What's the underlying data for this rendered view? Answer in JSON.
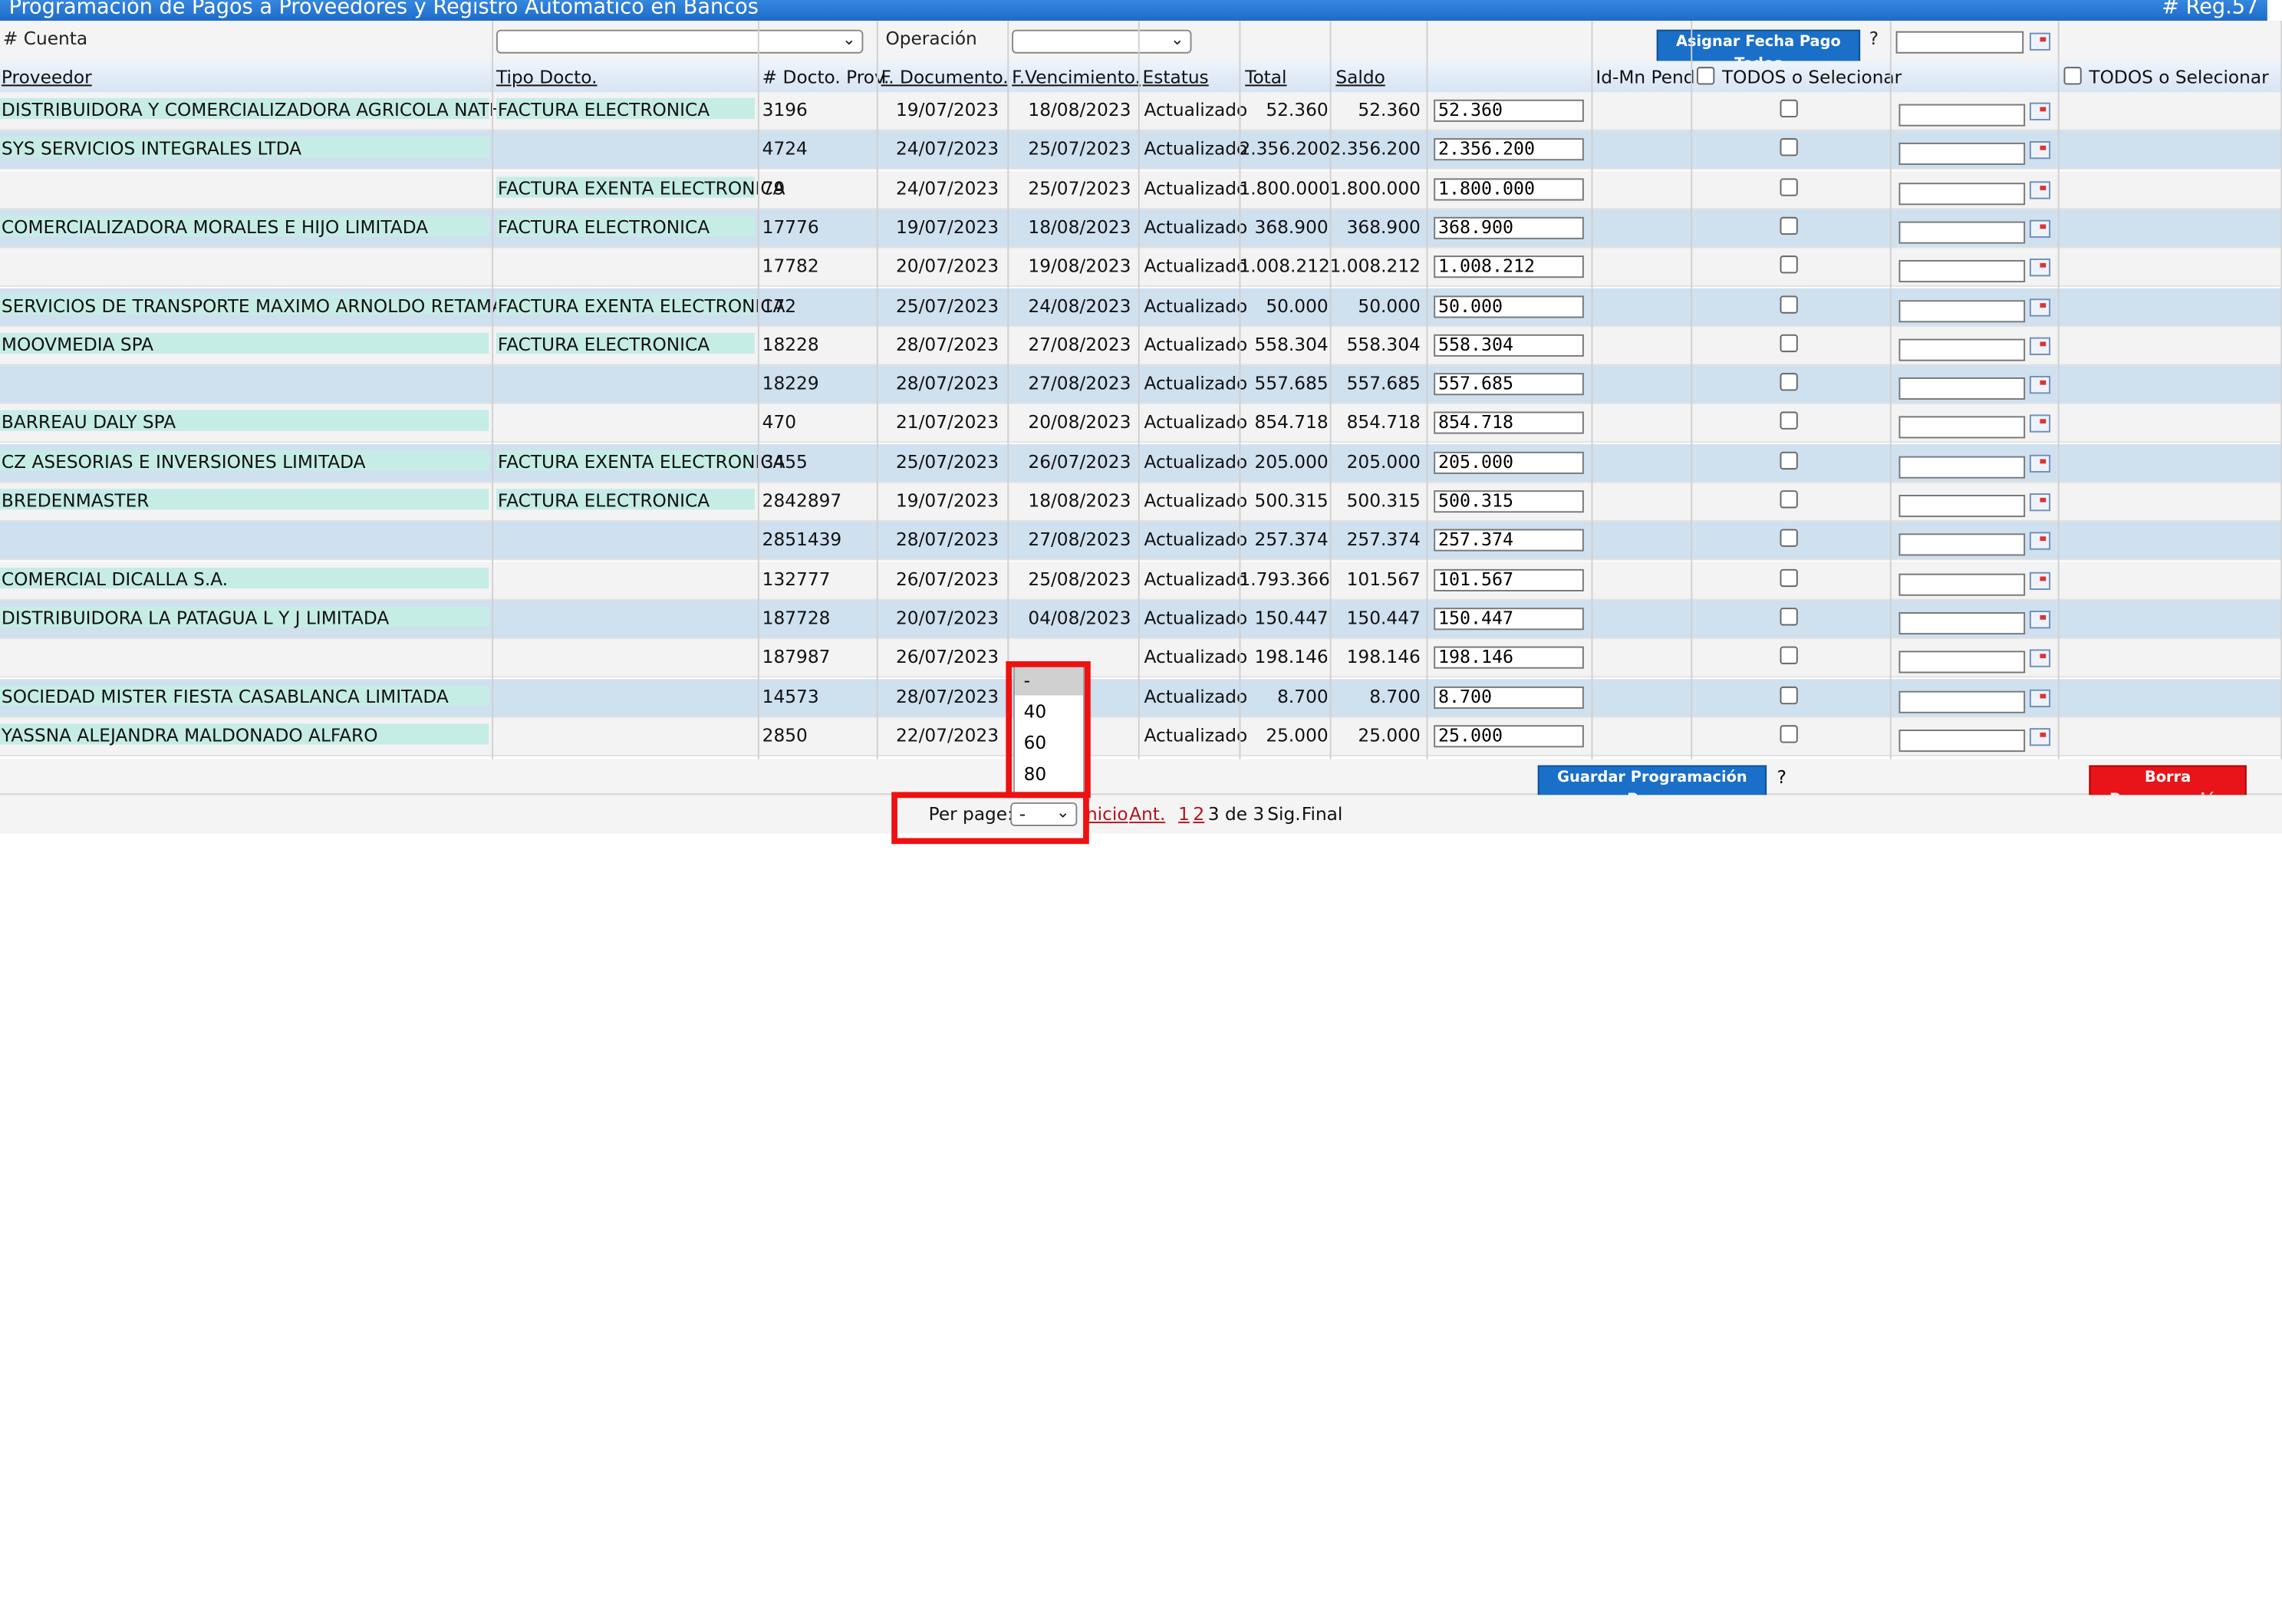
{
  "title": "Programación de Pagos a Proveedores y Registro Automatico en Bancos",
  "reg": "# Reg.57",
  "filters": {
    "cuenta_label": "# Cuenta",
    "operacion_label": "Operación",
    "asignar_button": "Asignar Fecha Pago Todos",
    "help": "?"
  },
  "columns": {
    "proveedor": "Proveedor",
    "tipo": "Tipo Docto.",
    "num": "# Docto. Prov.",
    "fdoc": "F. Documento.",
    "fven": "F.Vencimiento.",
    "estatus": "Estatus",
    "total": "Total",
    "saldo": "Saldo",
    "idmn": "Id-Mn Pend",
    "todos1": "TODOS o Selecionar",
    "todos2": "TODOS o Selecionar"
  },
  "rows": [
    {
      "proveedor": "DISTRIBUIDORA Y COMERCIALIZADORA AGRICOLA NATHALIE",
      "tipo": "FACTURA ELECTRONICA",
      "num": "3196",
      "fdoc": "19/07/2023",
      "fven": "18/08/2023",
      "estatus": "Actualizado",
      "total": "52.360",
      "saldo": "52.360",
      "monto": "52.360"
    },
    {
      "proveedor": "SYS SERVICIOS INTEGRALES LTDA",
      "tipo": "",
      "num": "4724",
      "fdoc": "24/07/2023",
      "fven": "25/07/2023",
      "estatus": "Actualizado",
      "total": "2.356.200",
      "saldo": "2.356.200",
      "monto": "2.356.200"
    },
    {
      "proveedor": "",
      "tipo": "FACTURA EXENTA ELECTRONICA",
      "num": "79",
      "fdoc": "24/07/2023",
      "fven": "25/07/2023",
      "estatus": "Actualizado",
      "total": "1.800.000",
      "saldo": "1.800.000",
      "monto": "1.800.000"
    },
    {
      "proveedor": "COMERCIALIZADORA MORALES E HIJO LIMITADA",
      "tipo": "FACTURA ELECTRONICA",
      "num": "17776",
      "fdoc": "19/07/2023",
      "fven": "18/08/2023",
      "estatus": "Actualizado",
      "total": "368.900",
      "saldo": "368.900",
      "monto": "368.900"
    },
    {
      "proveedor": "",
      "tipo": "",
      "num": "17782",
      "fdoc": "20/07/2023",
      "fven": "19/08/2023",
      "estatus": "Actualizado",
      "total": "1.008.212",
      "saldo": "1.008.212",
      "monto": "1.008.212"
    },
    {
      "proveedor": "SERVICIOS DE TRANSPORTE MAXIMO ARNOLDO RETAMALES",
      "tipo": "FACTURA EXENTA ELECTRONICA",
      "num": "172",
      "fdoc": "25/07/2023",
      "fven": "24/08/2023",
      "estatus": "Actualizado",
      "total": "50.000",
      "saldo": "50.000",
      "monto": "50.000"
    },
    {
      "proveedor": "MOOVMEDIA SPA",
      "tipo": "FACTURA ELECTRONICA",
      "num": "18228",
      "fdoc": "28/07/2023",
      "fven": "27/08/2023",
      "estatus": "Actualizado",
      "total": "558.304",
      "saldo": "558.304",
      "monto": "558.304"
    },
    {
      "proveedor": "",
      "tipo": "",
      "num": "18229",
      "fdoc": "28/07/2023",
      "fven": "27/08/2023",
      "estatus": "Actualizado",
      "total": "557.685",
      "saldo": "557.685",
      "monto": "557.685"
    },
    {
      "proveedor": "BARREAU DALY SPA",
      "tipo": "",
      "num": "470",
      "fdoc": "21/07/2023",
      "fven": "20/08/2023",
      "estatus": "Actualizado",
      "total": "854.718",
      "saldo": "854.718",
      "monto": "854.718"
    },
    {
      "proveedor": "CZ ASESORIAS E INVERSIONES LIMITADA",
      "tipo": "FACTURA EXENTA ELECTRONICA",
      "num": "3455",
      "fdoc": "25/07/2023",
      "fven": "26/07/2023",
      "estatus": "Actualizado",
      "total": "205.000",
      "saldo": "205.000",
      "monto": "205.000"
    },
    {
      "proveedor": "BREDENMASTER",
      "tipo": "FACTURA ELECTRONICA",
      "num": "2842897",
      "fdoc": "19/07/2023",
      "fven": "18/08/2023",
      "estatus": "Actualizado",
      "total": "500.315",
      "saldo": "500.315",
      "monto": "500.315"
    },
    {
      "proveedor": "",
      "tipo": "",
      "num": "2851439",
      "fdoc": "28/07/2023",
      "fven": "27/08/2023",
      "estatus": "Actualizado",
      "total": "257.374",
      "saldo": "257.374",
      "monto": "257.374"
    },
    {
      "proveedor": "COMERCIAL DICALLA S.A.",
      "tipo": "",
      "num": "132777",
      "fdoc": "26/07/2023",
      "fven": "25/08/2023",
      "estatus": "Actualizado",
      "total": "1.793.366",
      "saldo": "101.567",
      "monto": "101.567"
    },
    {
      "proveedor": "DISTRIBUIDORA LA PATAGUA L Y J LIMITADA",
      "tipo": "",
      "num": "187728",
      "fdoc": "20/07/2023",
      "fven": "04/08/2023",
      "estatus": "Actualizado",
      "total": "150.447",
      "saldo": "150.447",
      "monto": "150.447"
    },
    {
      "proveedor": "",
      "tipo": "",
      "num": "187987",
      "fdoc": "26/07/2023",
      "fven": "",
      "estatus": "Actualizado",
      "total": "198.146",
      "saldo": "198.146",
      "monto": "198.146"
    },
    {
      "proveedor": "SOCIEDAD MISTER FIESTA CASABLANCA LIMITADA",
      "tipo": "",
      "num": "14573",
      "fdoc": "28/07/2023",
      "fven": "023",
      "estatus": "Actualizado",
      "total": "8.700",
      "saldo": "8.700",
      "monto": "8.700"
    },
    {
      "proveedor": "YASSNA ALEJANDRA MALDONADO ALFARO",
      "tipo": "",
      "num": "2850",
      "fdoc": "22/07/2023",
      "fven": "023",
      "estatus": "Actualizado",
      "total": "25.000",
      "saldo": "25.000",
      "monto": "25.000"
    }
  ],
  "footer": {
    "guardar": "Guardar Programación Pagos",
    "help": "?",
    "borra": "Borra Programación"
  },
  "pager": {
    "per_page_label": "Per page:",
    "per_page_value": "-",
    "options": [
      "-",
      "40",
      "60",
      "80"
    ],
    "inicio": "nicio",
    "ant": "Ant.",
    "p1": "1",
    "p2": "2",
    "info": "3 de 3",
    "sig": "Sig.",
    "final": "Final"
  }
}
